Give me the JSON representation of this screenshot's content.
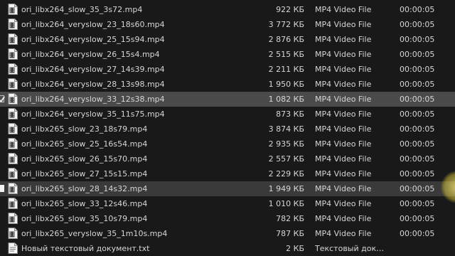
{
  "files": [
    {
      "name": "ori_libx264_slow_35_3s72.mp4",
      "size": "922 КБ",
      "type": "MP4 Video File",
      "duration": "00:00:05",
      "icon": "video-file-icon"
    },
    {
      "name": "ori_libx264_veryslow_23_18s60.mp4",
      "size": "3 772 КБ",
      "type": "MP4 Video File",
      "duration": "00:00:05",
      "icon": "video-file-icon"
    },
    {
      "name": "ori_libx264_veryslow_25_15s94.mp4",
      "size": "2 876 КБ",
      "type": "MP4 Video File",
      "duration": "00:00:05",
      "icon": "video-file-icon"
    },
    {
      "name": "ori_libx264_veryslow_26_15s4.mp4",
      "size": "2 515 КБ",
      "type": "MP4 Video File",
      "duration": "00:00:05",
      "icon": "video-file-icon"
    },
    {
      "name": "ori_libx264_veryslow_27_14s39.mp4",
      "size": "2 211 КБ",
      "type": "MP4 Video File",
      "duration": "00:00:05",
      "icon": "video-file-icon"
    },
    {
      "name": "ori_libx264_veryslow_28_13s98.mp4",
      "size": "1 950 КБ",
      "type": "MP4 Video File",
      "duration": "00:00:05",
      "icon": "video-file-icon"
    },
    {
      "name": "ori_libx264_veryslow_33_12s38.mp4",
      "size": "1 082 КБ",
      "type": "MP4 Video File",
      "duration": "00:00:05",
      "icon": "video-file-icon"
    },
    {
      "name": "ori_libx264_veryslow_35_11s75.mp4",
      "size": "873 КБ",
      "type": "MP4 Video File",
      "duration": "00:00:05",
      "icon": "video-file-icon"
    },
    {
      "name": "ori_libx265_slow_23_18s79.mp4",
      "size": "3 874 КБ",
      "type": "MP4 Video File",
      "duration": "00:00:05",
      "icon": "video-file-icon"
    },
    {
      "name": "ori_libx265_slow_25_16s54.mp4",
      "size": "2 935 КБ",
      "type": "MP4 Video File",
      "duration": "00:00:05",
      "icon": "video-file-icon"
    },
    {
      "name": "ori_libx265_slow_26_15s70.mp4",
      "size": "2 557 КБ",
      "type": "MP4 Video File",
      "duration": "00:00:05",
      "icon": "video-file-icon"
    },
    {
      "name": "ori_libx265_slow_27_15s15.mp4",
      "size": "2 229 КБ",
      "type": "MP4 Video File",
      "duration": "00:00:05",
      "icon": "video-file-icon"
    },
    {
      "name": "ori_libx265_slow_28_14s32.mp4",
      "size": "1 949 КБ",
      "type": "MP4 Video File",
      "duration": "00:00:05",
      "icon": "video-file-icon"
    },
    {
      "name": "ori_libx265_slow_33_12s46.mp4",
      "size": "1 010 КБ",
      "type": "MP4 Video File",
      "duration": "00:00:05",
      "icon": "video-file-icon"
    },
    {
      "name": "ori_libx265_slow_35_10s79.mp4",
      "size": "782 КБ",
      "type": "MP4 Video File",
      "duration": "00:00:05",
      "icon": "video-file-icon"
    },
    {
      "name": "ori_libx265_veryslow_35_1m10s.mp4",
      "size": "787 КБ",
      "type": "MP4 Video File",
      "duration": "00:00:05",
      "icon": "video-file-icon"
    },
    {
      "name": "Новый текстовый документ.txt",
      "size": "2 КБ",
      "type": "Текстовый документ",
      "duration": "",
      "icon": "text-file-icon"
    }
  ],
  "colors": {
    "background": "#191919",
    "text": "#d6d6d6",
    "row_highlight": "#4a4a4a",
    "row_hover": "#3a3a3a"
  }
}
